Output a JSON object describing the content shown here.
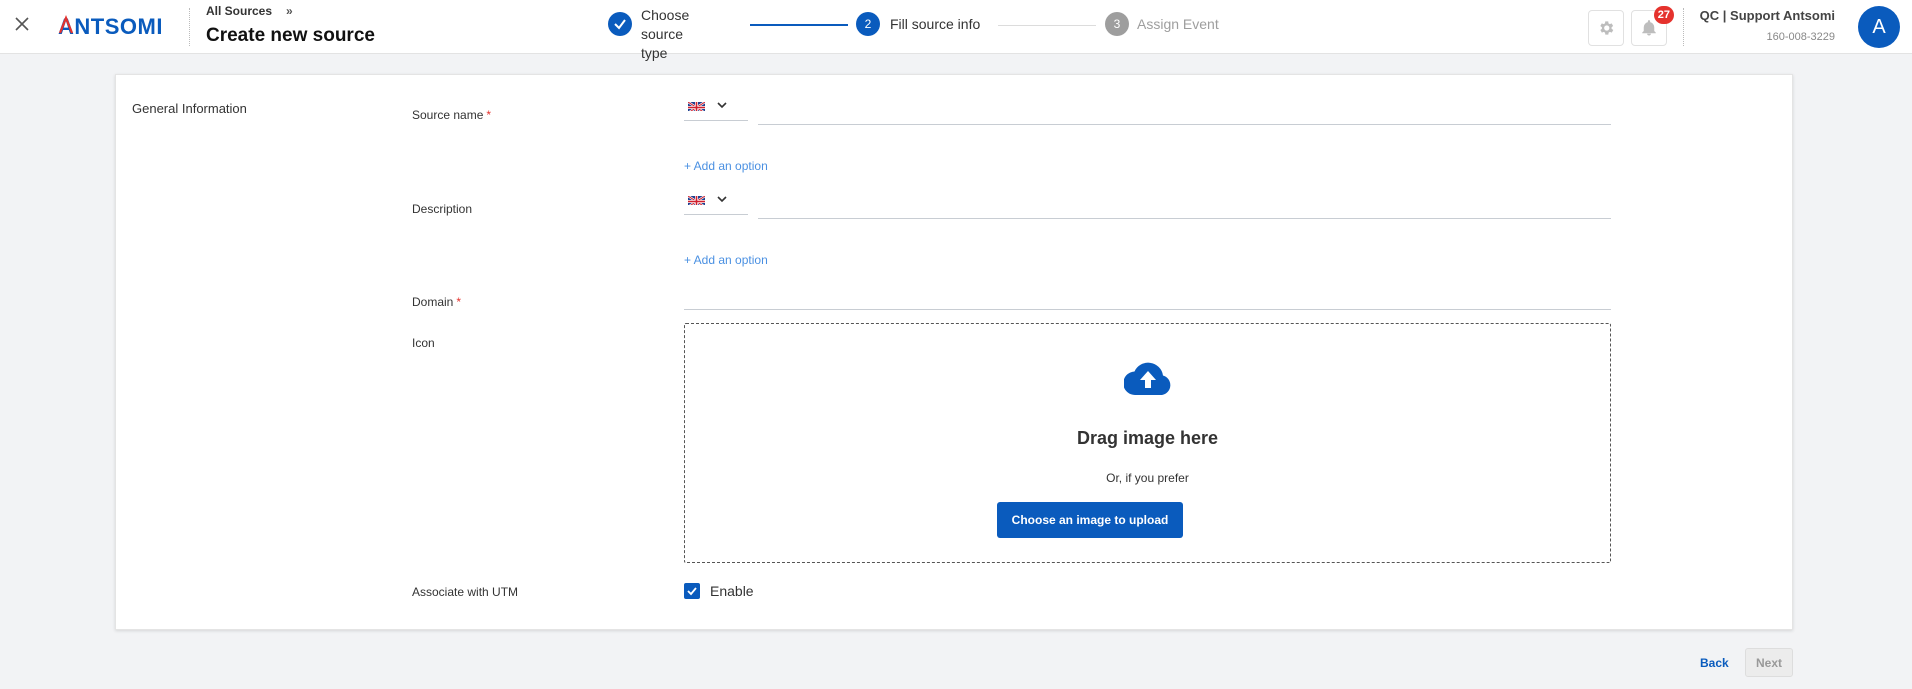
{
  "header": {
    "breadcrumb": "All Sources",
    "breadcrumb_separator": "»",
    "title": "Create new source",
    "logo_text": "ANTSOMI",
    "notification_count": "27",
    "user_name": "QC | Support Antsomi",
    "user_phone": "160-008-3229",
    "avatar_letter": "A"
  },
  "stepper": {
    "steps": [
      {
        "number": "1",
        "label_line1": "Choose source",
        "label_line2": "type",
        "state": "done"
      },
      {
        "number": "2",
        "label": "Fill source info",
        "state": "active"
      },
      {
        "number": "3",
        "label": "Assign Event",
        "state": "pending"
      }
    ]
  },
  "form": {
    "section_title": "General Information",
    "source_name_label": "Source name",
    "source_name_value": "",
    "description_label": "Description",
    "description_value": "",
    "add_option_label": "+ Add an option",
    "domain_label": "Domain",
    "domain_value": "",
    "required_mark": "*",
    "icon_label": "Icon",
    "drag_title": "Drag image here",
    "or_text": "Or, if you prefer",
    "upload_button": "Choose an image to upload",
    "utm_label": "Associate with UTM",
    "utm_checkbox_label": "Enable",
    "utm_enabled": true
  },
  "footer": {
    "back_label": "Back",
    "next_label": "Next"
  },
  "colors": {
    "primary": "#0a5bbd",
    "link": "#4a90e2",
    "badge": "#e5322d",
    "disabled": "#9e9e9e"
  },
  "icons": [
    "close-icon",
    "check-icon",
    "gear-icon",
    "bell-icon",
    "flag-uk-icon",
    "chevron-down-icon",
    "cloud-upload-icon"
  ]
}
